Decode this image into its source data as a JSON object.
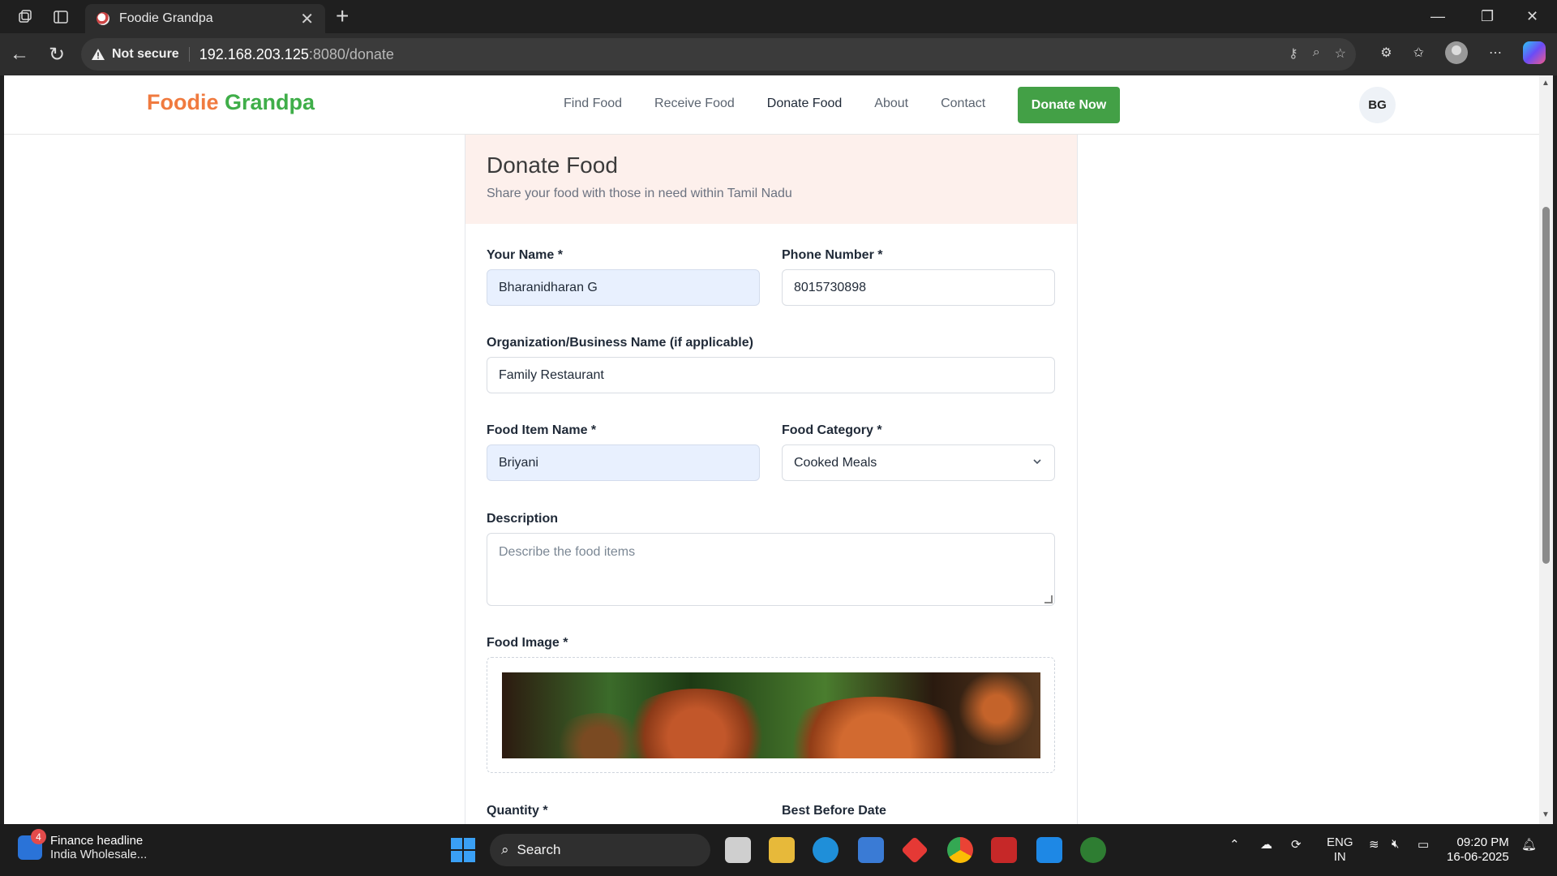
{
  "browser": {
    "tab_title": "Foodie Grandpa",
    "security_label": "Not secure",
    "url_host": "192.168.203.125",
    "url_path": ":8080/donate"
  },
  "site": {
    "logo_part1": "Foodie",
    "logo_part2": "Grandpa",
    "nav": [
      "Find Food",
      "Receive Food",
      "Donate Food",
      "About",
      "Contact"
    ],
    "active_nav": "Donate Food",
    "cta": "Donate Now",
    "user_initials": "BG"
  },
  "form": {
    "title": "Donate Food",
    "subtitle": "Share your food with those in need within Tamil Nadu",
    "name_label": "Your Name *",
    "name_value": "Bharanidharan G",
    "phone_label": "Phone Number *",
    "phone_value": "8015730898",
    "org_label": "Organization/Business Name (if applicable)",
    "org_value": "Family Restaurant",
    "item_label": "Food Item Name *",
    "item_value": "Briyani",
    "category_label": "Food Category *",
    "category_value": "Cooked Meals",
    "description_label": "Description",
    "description_placeholder": "Describe the food items",
    "image_label": "Food Image *",
    "quantity_label": "Quantity *",
    "best_before_label": "Best Before Date"
  },
  "taskbar": {
    "news_badge": "4",
    "news_title": "Finance headline",
    "news_subtitle": "India Wholesale...",
    "search_label": "Search",
    "lang_top": "ENG",
    "lang_bottom": "IN",
    "time": "09:20 PM",
    "date": "16-06-2025"
  },
  "colors": {
    "logo_orange": "#f07a3f",
    "logo_green": "#3fae49",
    "cta_green": "#43a046",
    "form_header_bg": "#fdf0ec",
    "autofill_bg": "#e8f0fe"
  }
}
